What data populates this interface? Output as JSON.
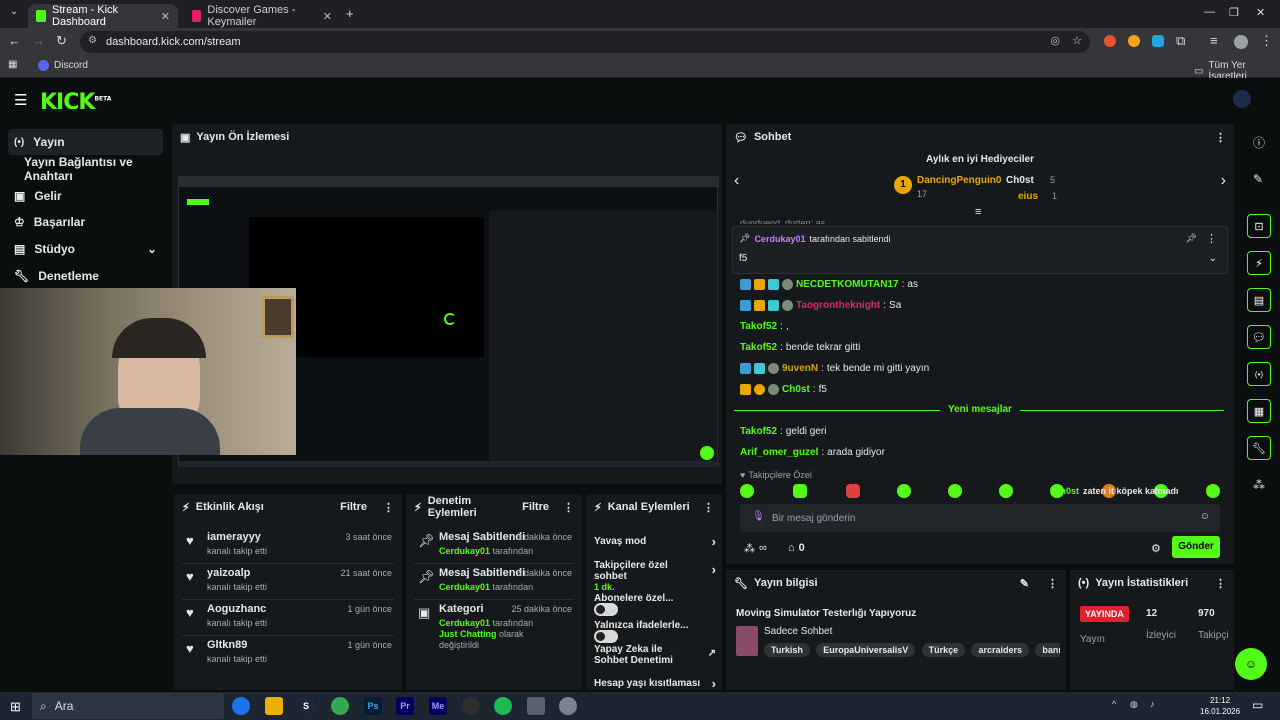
{
  "browser": {
    "tabs": [
      {
        "title": "Stream - Kick Dashboard",
        "active": true
      },
      {
        "title": "Discover Games - Keymailer",
        "active": false
      }
    ],
    "url": "dashboard.kick.com/stream",
    "bookmarks": {
      "discord": "Discord",
      "all_bookmarks": "Tüm Yer İşaretleri"
    }
  },
  "kick": {
    "logo": "KICK",
    "logo_tag": "BETA",
    "accent": "#53fc18",
    "sidebar": [
      {
        "label": "Yayın",
        "icon": "broadcast-icon",
        "active": true
      },
      {
        "label": "Yayın Bağlantısı ve Anahtarı",
        "icon": "",
        "active": false
      },
      {
        "label": "Gelir",
        "icon": "money-icon",
        "active": false
      },
      {
        "label": "Başarılar",
        "icon": "trophy-icon",
        "active": false
      },
      {
        "label": "Stüdyo",
        "icon": "studio-icon",
        "active": false
      },
      {
        "label": "Denetleme",
        "icon": "wrench-icon",
        "active": false
      }
    ],
    "preview": {
      "title": "Yayın Ön İzlemesi"
    },
    "activity": {
      "title": "Etkinlik Akışı",
      "filter": "Filtre",
      "items": [
        {
          "name": "iamerayyy",
          "action": "kanalı takip etti",
          "time": "3 saat önce"
        },
        {
          "name": "yaizoalp",
          "action": "kanalı takip etti",
          "time": "21 saat önce"
        },
        {
          "name": "Aoguzhanc",
          "action": "kanalı takip etti",
          "time": "1 gün önce"
        },
        {
          "name": "Gltkn89",
          "action": "kanalı takip etti",
          "time": "1 gün önce"
        }
      ]
    },
    "mod_actions": {
      "title": "Denetim Eylemleri",
      "filter": "Filtre",
      "items": [
        {
          "title": "Mesaj Sabitlendi",
          "user": "Cerdukay01",
          "suffix": "tarafından",
          "time": "3 dakika önce"
        },
        {
          "title": "Mesaj Sabitlendi",
          "user": "Cerdukay01",
          "suffix": "tarafından",
          "time": "6 dakika önce"
        },
        {
          "title": "Kategori",
          "user": "Cerdukay01",
          "suffix": "tarafından",
          "detail": "Just Chatting",
          "detail_suffix": "olarak değiştirildi",
          "time": "25 dakika önce"
        }
      ]
    },
    "channel_actions": {
      "title": "Kanal Eylemleri",
      "items": [
        {
          "label": "Yavaş mod",
          "kind": "arrow"
        },
        {
          "label": "Takipçilere özel sohbet",
          "sub": "1 dk.",
          "kind": "arrow"
        },
        {
          "label": "Abonelere özel...",
          "kind": "toggle"
        },
        {
          "label": "Yalnızca ifadelerle...",
          "kind": "toggle"
        },
        {
          "label": "Yapay Zeka ile Sohbet Denetimi",
          "kind": "external"
        },
        {
          "label": "Hesap yaşı kısıtlaması",
          "kind": "arrow"
        }
      ]
    },
    "chat": {
      "title": "Sohbet",
      "gifters_title": "Aylık en iyi Hediyeciler",
      "gifters": [
        {
          "rank": "1",
          "name": "DancingPenguin0",
          "count": "17"
        },
        {
          "name": "Ch0st",
          "count": "5"
        },
        {
          "name": "eius",
          "count": "1"
        }
      ],
      "partial_top": "dunduend_durten: as",
      "pinned": {
        "by": "Cerdukay01",
        "suffix": "tarafından sabitlendi",
        "text": "f5"
      },
      "messages": [
        {
          "user": "NECDETKOMUTAN17",
          "text": "as",
          "color": "#53fc18"
        },
        {
          "user": "Taogrontheknight",
          "text": "Sa",
          "color": "#e0246e"
        },
        {
          "user": "Takof52",
          "text": ",",
          "color": "#53fc18"
        },
        {
          "user": "Takof52",
          "text": "bende tekrar gitti",
          "color": "#53fc18"
        },
        {
          "user": "9uvenN",
          "text": "tek bende mi gitti yayın",
          "color": "#d8a10d"
        },
        {
          "user": "Ch0st",
          "text": "f5",
          "color": "#53fc18"
        }
      ],
      "new_messages_label": "Yeni mesajlar",
      "messages_after": [
        {
          "user": "Takof52",
          "text": "geldi geri",
          "color": "#53fc18"
        },
        {
          "user": "Arif_omer_guzel",
          "text": "arada gidiyor",
          "color": "#53fc18"
        }
      ],
      "follower_emotes": "Takipçilere Özel",
      "overlay_user": "Ch0st",
      "overlay_text": "zaten it köpek kalmadı",
      "placeholder": "Bir mesaj gönderin",
      "viewer_count": "0",
      "send": "Gönder"
    },
    "stream_info": {
      "title": "Yayın bilgisi",
      "stream_title": "Moving Simulator Testerlığı Yapıyoruz",
      "category": "Sadece Sohbet",
      "tags": [
        "Turkish",
        "EuropaUniversalisV",
        "Türkçe",
        "arcraiders",
        "bannerlord"
      ]
    },
    "stats": {
      "title": "Yayın İstatistikleri",
      "live_badge": "YAYINDA",
      "live_label": "Yayın",
      "viewers": "12",
      "viewers_label": "İzleyici",
      "followers": "970",
      "followers_label": "Takipçi"
    }
  },
  "taskbar": {
    "search": "Ara",
    "time": "21:12",
    "date": "16.01.2026"
  }
}
